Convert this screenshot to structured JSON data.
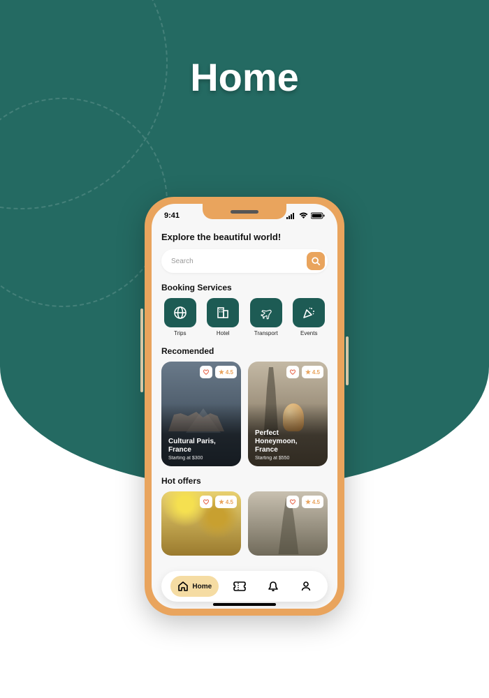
{
  "page": {
    "title": "Home"
  },
  "status": {
    "time": "9:41"
  },
  "headline": "Explore the beautiful world!",
  "search": {
    "placeholder": "Search"
  },
  "sections": {
    "booking_title": "Booking Services",
    "recommended_title": "Recomended",
    "hot_offers_title": "Hot offers"
  },
  "services": [
    {
      "label": "Trips"
    },
    {
      "label": "Hotel"
    },
    {
      "label": "Transport"
    },
    {
      "label": "Events"
    }
  ],
  "recommended": [
    {
      "title": "Cultural Paris, France",
      "subtitle": "Starting at $300",
      "rating": "4.5"
    },
    {
      "title": "Perfect Honeymoon, France",
      "subtitle": "Starting at $550",
      "rating": "4.5"
    }
  ],
  "hot_offers": [
    {
      "rating": "4.5"
    },
    {
      "rating": "4.5"
    }
  ],
  "nav": {
    "home": "Home"
  },
  "colors": {
    "teal": "#246a62",
    "orange": "#e9a45d",
    "service_box": "#1d5b54"
  }
}
